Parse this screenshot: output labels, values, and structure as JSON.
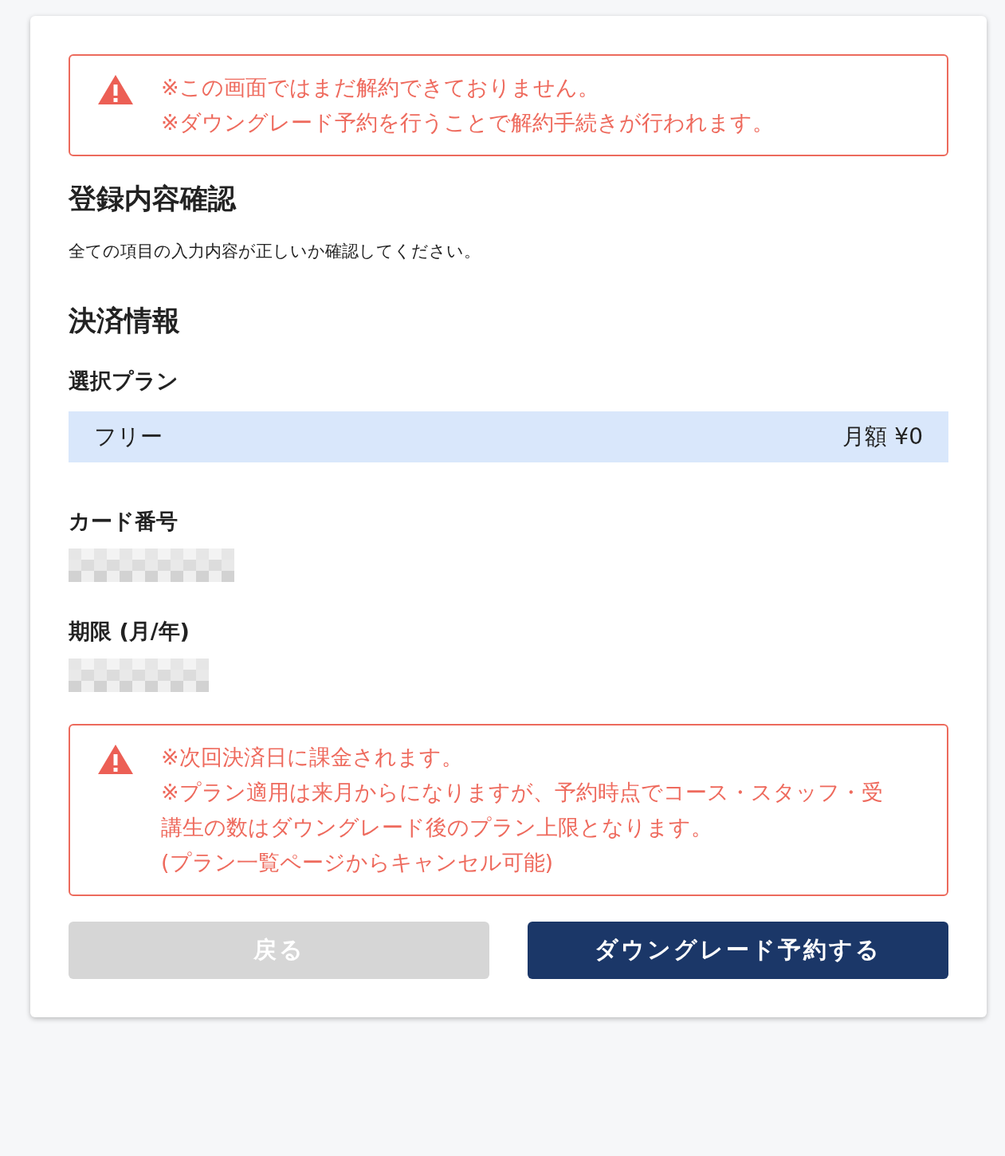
{
  "top_alert": {
    "lines": [
      "※この画面ではまだ解約できておりません。",
      "※ダウングレード予約を行うことで解約手続きが行われます。"
    ]
  },
  "title": "登録内容確認",
  "description": "全ての項目の入力内容が正しいか確認してください。",
  "section_title": "決済情報",
  "plan": {
    "label": "選択プラン",
    "name": "フリー",
    "price": "月額 ¥0"
  },
  "fields": [
    {
      "label": "カード番号"
    },
    {
      "label": "期限 (月/年)"
    }
  ],
  "bottom_alert": {
    "lines": [
      "※次回決済日に課金されます。",
      "※プラン適用は来月からになりますが、予約時点でコース・スタッフ・受講生の数はダウングレード後のプラン上限となります。",
      "(プラン一覧ページからキャンセル可能)"
    ]
  },
  "buttons": [
    {
      "label": "戻る",
      "kind": "secondary",
      "disabled": true
    },
    {
      "label": "ダウングレード予約する",
      "kind": "primary",
      "disabled": false
    }
  ]
}
